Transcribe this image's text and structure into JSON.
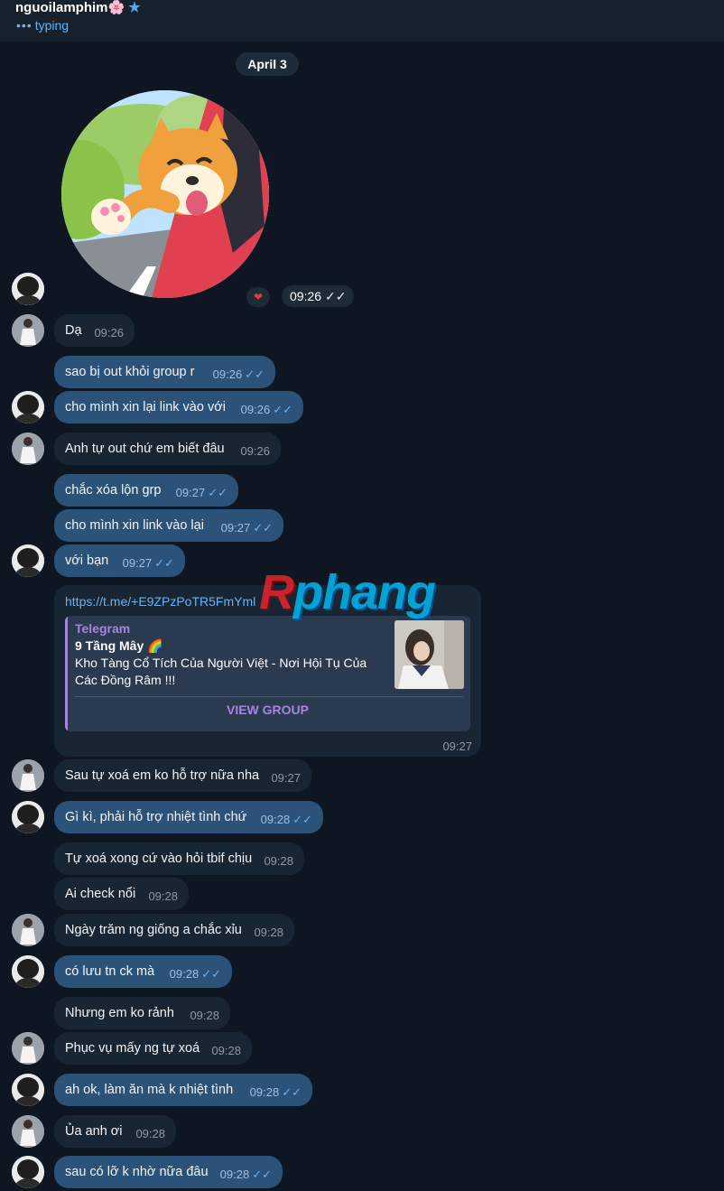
{
  "header": {
    "name": "nguoilamphim",
    "name_emoji": "🌸",
    "verified_icon": "★",
    "typing_dots": "•••",
    "typing_text": "typing"
  },
  "date_divider": "April 3",
  "sticker": {
    "reaction": "❤",
    "time": "09:26",
    "ticks": "✓✓"
  },
  "messages": [
    {
      "dir": "in",
      "text": "Dạ",
      "time": "09:26"
    },
    {
      "dir": "out",
      "text": "sao bị out khỏi group r",
      "time": "09:26",
      "ticks": "✓✓"
    },
    {
      "dir": "out",
      "text": "cho mình xin lại link vào với",
      "time": "09:26",
      "ticks": "✓✓"
    },
    {
      "dir": "in",
      "text": "Anh tự out chứ em biết đâu",
      "time": "09:26"
    },
    {
      "dir": "out",
      "text": "chắc xóa lộn grp",
      "time": "09:27",
      "ticks": "✓✓"
    },
    {
      "dir": "out",
      "text": "cho mình xin link vào lại",
      "time": "09:27",
      "ticks": "✓✓"
    },
    {
      "dir": "out",
      "text": "với bạn",
      "time": "09:27",
      "ticks": "✓✓"
    },
    {
      "dir": "in",
      "text": "Sau tự xoá em ko hỗ trợ nữa nha",
      "time": "09:27"
    },
    {
      "dir": "out",
      "text": "Gì kì, phải hỗ trợ nhiệt tình chứ",
      "time": "09:28",
      "ticks": "✓✓"
    },
    {
      "dir": "in",
      "text": "Tự xoá xong cứ vào hỏi tbif chịu",
      "time": "09:28"
    },
    {
      "dir": "in",
      "text": "Ai check nổi",
      "time": "09:28"
    },
    {
      "dir": "in",
      "text": "Ngày trăm ng giống a chắc xỉu",
      "time": "09:28"
    },
    {
      "dir": "out",
      "text": "có lưu tn ck mà",
      "time": "09:28",
      "ticks": "✓✓"
    },
    {
      "dir": "in",
      "text": "Nhưng em ko rảnh",
      "time": "09:28"
    },
    {
      "dir": "in",
      "text": "Phục vụ mấy ng tự xoá",
      "time": "09:28"
    },
    {
      "dir": "out",
      "text": "ah ok, làm ăn mà k nhiệt tình",
      "time": "09:28",
      "ticks": "✓✓"
    },
    {
      "dir": "in",
      "text": "Ủa anh ơi",
      "time": "09:28"
    },
    {
      "dir": "out",
      "text": "sau có lỡ k nhờ nữa đâu",
      "time": "09:28",
      "ticks": "✓✓"
    }
  ],
  "link_message": {
    "url": "https://t.me/+E9ZPzPoTR5FmYml",
    "site": "Telegram",
    "group_name": "9 Tầng Mây 🌈",
    "description": "Kho Tàng Cổ Tích Của Người Việt - Nơi Hội Tụ Của Các Đồng Râm !!!",
    "button": "VIEW GROUP",
    "time": "09:27"
  },
  "watermark": {
    "first": "R",
    "rest": "phang"
  },
  "colors": {
    "background": "#0e1621",
    "incoming_bubble": "#182533",
    "outgoing_bubble": "#2b5278",
    "accent": "#6ab3f3",
    "preview_accent": "#a785dd"
  },
  "icons": {
    "avatar_me": "avatar-dark-hair-icon",
    "avatar_her": "avatar-girl-white-dress-icon",
    "read_ticks": "double-check-icon"
  }
}
